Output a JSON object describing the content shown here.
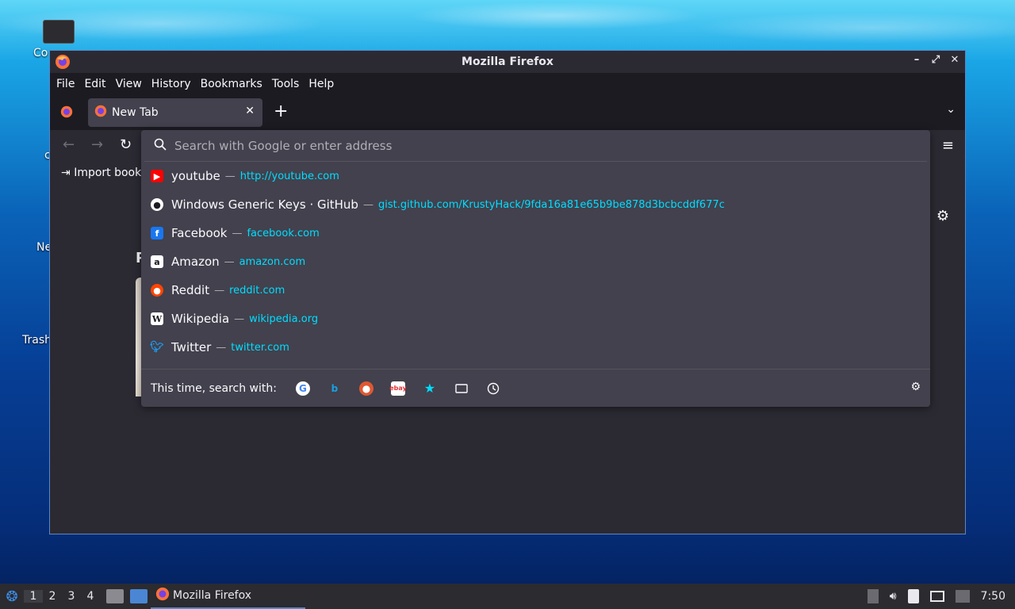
{
  "desktop": {
    "icons": [
      {
        "label": "Co"
      },
      {
        "label": "c"
      },
      {
        "label": "Ne"
      },
      {
        "label": "Trash"
      }
    ]
  },
  "window": {
    "title": "Mozilla Firefox",
    "controls": {
      "minimize": "–",
      "maximize": "⤢",
      "close": "✕"
    }
  },
  "menubar": {
    "items": [
      "File",
      "Edit",
      "View",
      "History",
      "Bookmarks",
      "Tools",
      "Help"
    ]
  },
  "tabs": [
    {
      "title": "New Tab",
      "close": "✕"
    }
  ],
  "toolbar": {
    "new_tab": "+",
    "tab_list": "⌄",
    "back": "←",
    "forward": "→",
    "reload": "↻",
    "menu": "≡"
  },
  "bookmarks": {
    "import_label": "Import book"
  },
  "urlbar": {
    "placeholder": "Search with Google or enter address",
    "suggestions": [
      {
        "title": "youtube",
        "sep": "—",
        "url": "http://youtube.com",
        "icon": "youtube-icon",
        "color": "#ff0000"
      },
      {
        "title": "Windows Generic Keys · GitHub",
        "sep": "—",
        "url": "gist.github.com/KrustyHack/9fda16a81e65b9be878d3bcbcddf677c",
        "icon": "github-icon",
        "color": "#ffffff"
      },
      {
        "title": "Facebook",
        "sep": "—",
        "url": "facebook.com",
        "icon": "facebook-icon",
        "color": "#1877f2"
      },
      {
        "title": "Amazon",
        "sep": "—",
        "url": "amazon.com",
        "icon": "amazon-icon",
        "color": "#ffffff"
      },
      {
        "title": "Reddit",
        "sep": "—",
        "url": "reddit.com",
        "icon": "reddit-icon",
        "color": "#ff4500"
      },
      {
        "title": "Wikipedia",
        "sep": "—",
        "url": "wikipedia.org",
        "icon": "wikipedia-icon",
        "color": "#ffffff"
      },
      {
        "title": "Twitter",
        "sep": "—",
        "url": "twitter.com",
        "icon": "twitter-icon",
        "color": "#1d9bf0"
      }
    ],
    "oneoff_label": "This time, search with:",
    "engines": [
      "google-icon",
      "bing-icon",
      "duckduckgo-icon",
      "ebay-icon",
      "bookmarks-star-icon",
      "tabs-icon",
      "history-icon"
    ]
  },
  "newtab": {
    "section_initial": "P"
  },
  "taskbar": {
    "workspaces": [
      "1",
      "2",
      "3",
      "4"
    ],
    "task_label": "Mozilla Firefox",
    "clock": "7:50"
  }
}
